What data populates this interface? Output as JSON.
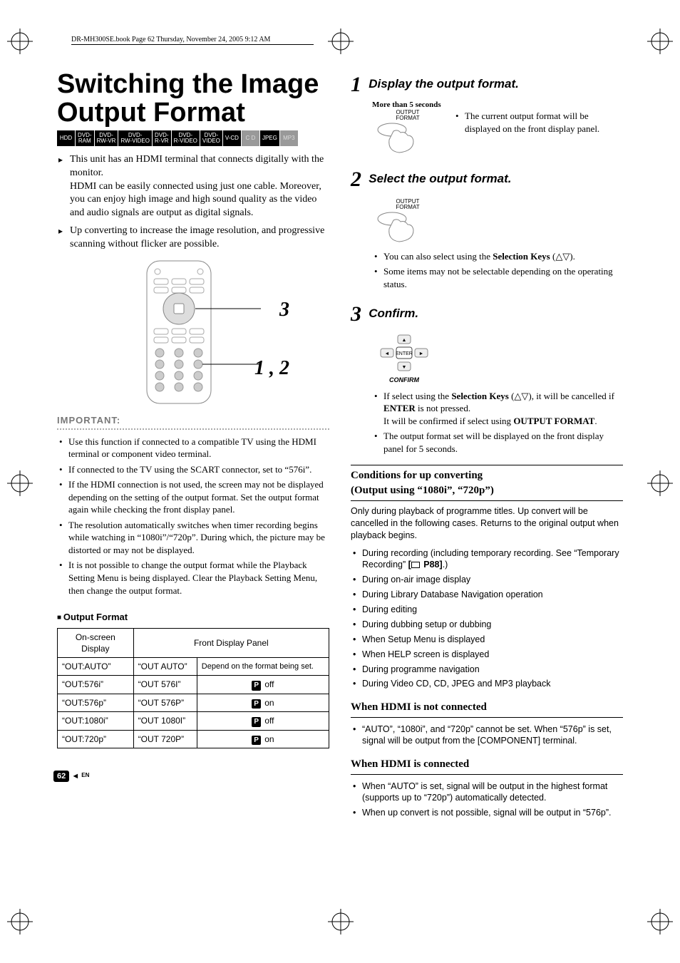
{
  "book_note": "DR-MH300SE.book  Page 62  Thursday, November 24, 2005  9:12 AM",
  "title": "Switching the Image Output Format",
  "badges": [
    {
      "t": "HDD",
      "dim": false
    },
    {
      "t": "DVD-\nRAM",
      "dim": false
    },
    {
      "t": "DVD-\nRW-VR",
      "dim": false
    },
    {
      "t": "DVD-\nRW-VIDEO",
      "dim": false
    },
    {
      "t": "DVD-\nR-VR",
      "dim": false
    },
    {
      "t": "DVD-\nR-VIDEO",
      "dim": false
    },
    {
      "t": "DVD-\nVIDEO",
      "dim": false
    },
    {
      "t": "V-CD",
      "dim": false
    },
    {
      "t": "C D",
      "dim": true
    },
    {
      "t": "JPEG",
      "dim": false
    },
    {
      "t": "MP3",
      "dim": true
    }
  ],
  "arrow_items": [
    "This unit has an HDMI terminal that connects digitally with the monitor.\nHDMI can be easily connected using just one cable. Moreover, you can enjoy high image and high sound quality as the video and audio signals are output as digital signals.",
    "Up converting to increase the image resolution, and progressive scanning without flicker are possible."
  ],
  "callouts": {
    "remote_3": "3",
    "remote_12": "1 , 2"
  },
  "important_label": "IMPORTANT:",
  "important_items": [
    "Use this function if connected to a compatible TV using the HDMI terminal or component video terminal.",
    "If connected to the TV using the SCART connector, set to “576i”.",
    "If the HDMI connection is not used, the screen may not be displayed depending on the setting of the output format. Set the output format again while checking the front display panel.",
    "The resolution automatically switches when timer recording begins while watching in “1080i”/“720p”. During which, the picture may be distorted or may not be displayed.",
    "It is not possible to change the output format while the Playback Setting Menu is being displayed. Clear the Playback Setting Menu, then change the output format."
  ],
  "output_format_head": "Output Format",
  "table": {
    "head_onscreen": "On-screen\nDisplay",
    "head_front": "Front Display Panel",
    "rows": [
      {
        "osd": "“OUT:AUTO”",
        "front": "“OUT AUTO”",
        "scan": "Depend on the format being set."
      },
      {
        "osd": "“OUT:576i”",
        "front": "“OUT  576I”",
        "scan_icon": "P",
        "scan": "off"
      },
      {
        "osd": "“OUT:576p”",
        "front": "“OUT  576P”",
        "scan_icon": "P",
        "scan": "on"
      },
      {
        "osd": "“OUT:1080i”",
        "front": "“OUT 1080I”",
        "scan_icon": "P",
        "scan": "off"
      },
      {
        "osd": "“OUT:720p”",
        "front": "“OUT  720P”",
        "scan_icon": "P",
        "scan": "on"
      }
    ]
  },
  "steps": {
    "s1": {
      "num": "1",
      "title": "Display the output format.",
      "hold": "More than 5 seconds",
      "btn": "OUTPUT\nFORMAT",
      "note": "The current output format will be displayed on the front display panel."
    },
    "s2": {
      "num": "2",
      "title": "Select the output format.",
      "btn": "OUTPUT\nFORMAT",
      "items": [
        "You can also select using the <b>Selection Keys</b> (△▽).",
        "Some items may not be selectable depending on the operating status."
      ]
    },
    "s3": {
      "num": "3",
      "title": "Confirm.",
      "confirm": "CONFIRM",
      "items_html": [
        "If select using the <b>Selection Keys</b> (△▽), it will be cancelled if <b>ENTER</b> is not pressed.<br>It will be confirmed if select using <b>OUTPUT FORMAT</b>.",
        "The output format set will be displayed on the front display panel for 5 seconds."
      ]
    }
  },
  "conditions": {
    "head": "Conditions for up converting\n(Output using “1080i”, “720p”)",
    "lead": "Only during playback of programme titles. Up convert will be cancelled in the following cases. Returns to the original output when playback begins.",
    "items": [
      "During recording (including temporary recording. See “Temporary Recording” [📖 P88].)",
      "During on-air image display",
      "During Library Database Navigation operation",
      "During editing",
      "During dubbing setup or dubbing",
      "When Setup Menu is displayed",
      "When HELP screen is displayed",
      "During programme navigation",
      "During Video CD, CD, JPEG and MP3 playback"
    ]
  },
  "hdmi_not": {
    "head": "When HDMI is not connected",
    "items": [
      "“AUTO”, “1080i”, and “720p” cannot be set. When “576p” is set, signal will be output from the [COMPONENT] terminal."
    ]
  },
  "hdmi_yes": {
    "head": "When HDMI is connected",
    "items": [
      "When “AUTO” is set, signal will be output in the highest format (supports up to “720p”) automatically detected.",
      "When up convert is not possible, signal will be output in “576p”."
    ]
  },
  "page_num": {
    "n": "62",
    "arrow": "◄",
    "lang": "EN"
  }
}
